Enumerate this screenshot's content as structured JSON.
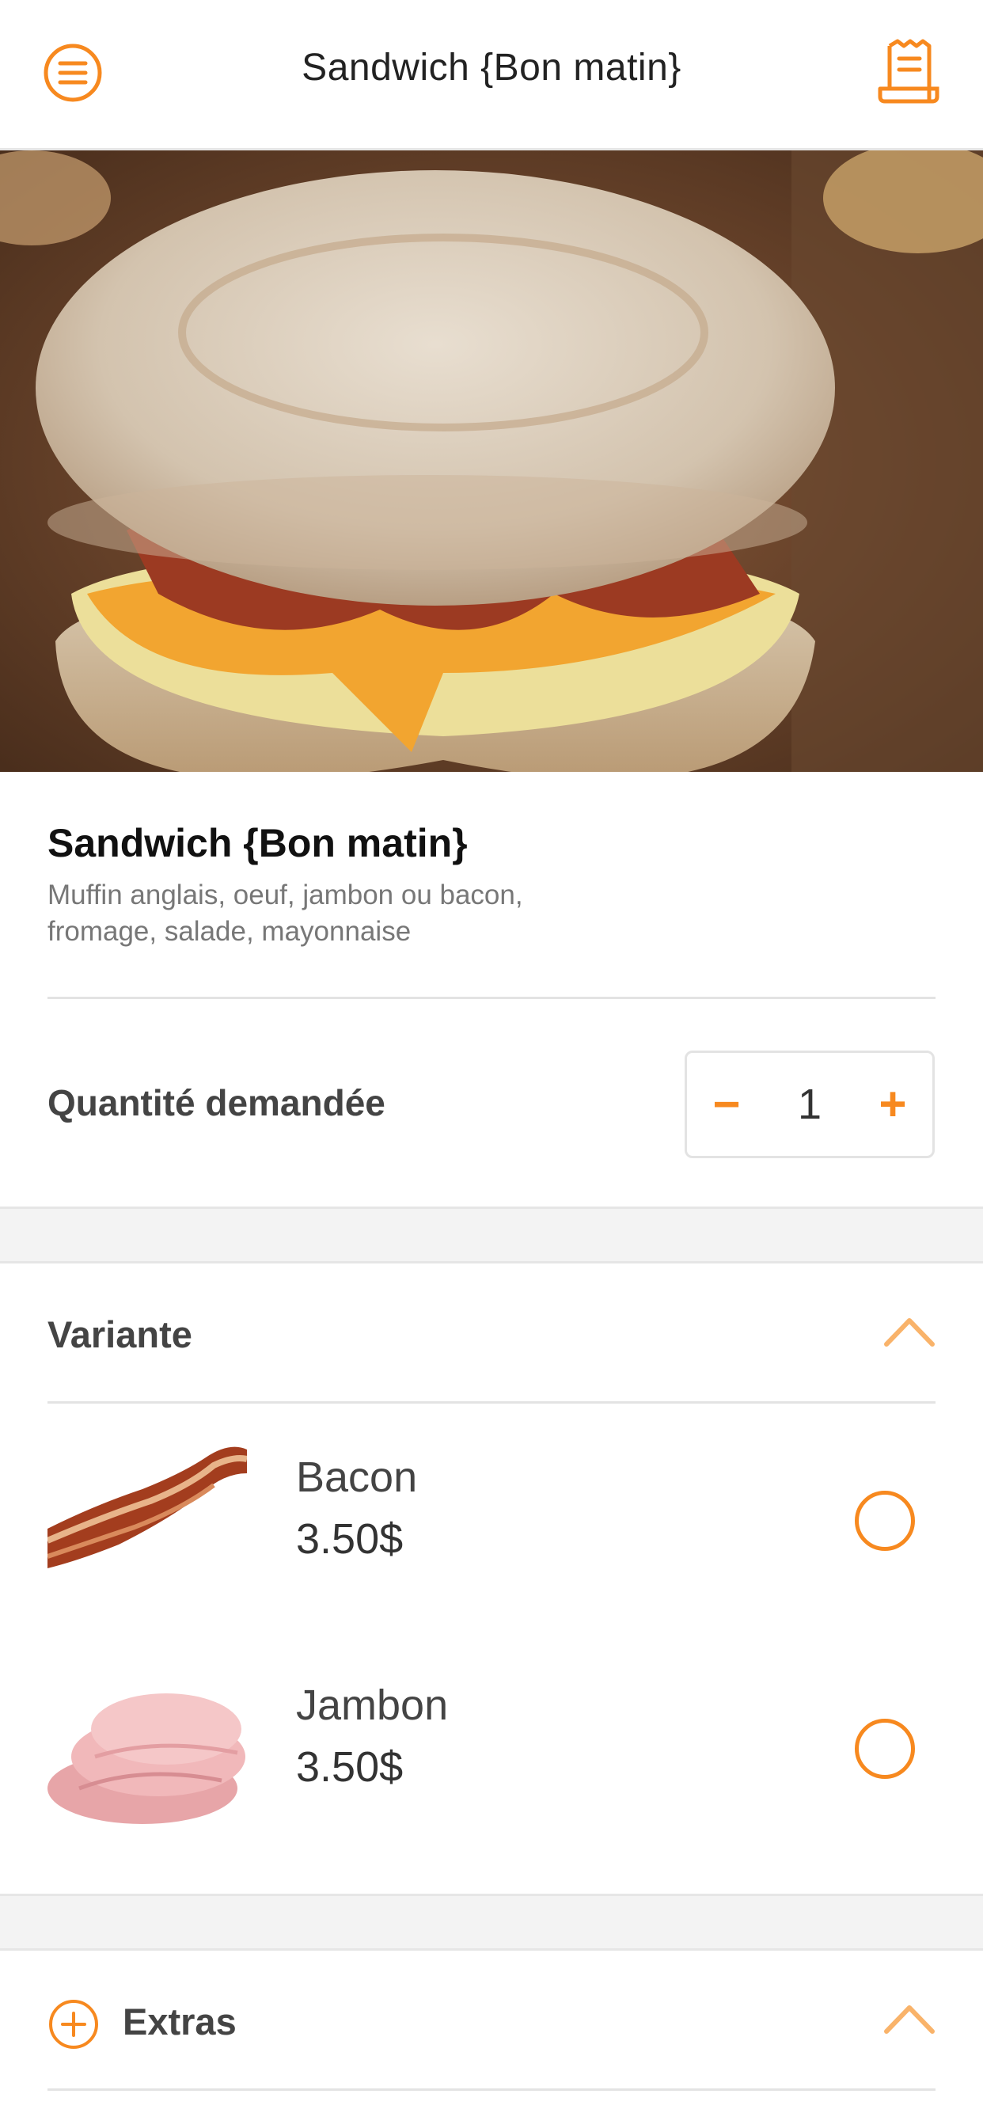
{
  "header": {
    "title": "Sandwich {Bon matin}",
    "menu_icon": "hamburger-menu-icon",
    "cart_icon": "receipt-icon"
  },
  "colors": {
    "accent": "#f7891f",
    "divider": "#e3e3e3",
    "section_gap": "#f3f3f3"
  },
  "product": {
    "name": "Sandwich {Bon matin}",
    "description": "Muffin anglais, oeuf, jambon ou bacon, fromage, salade, mayonnaise"
  },
  "quantity": {
    "label": "Quantité demandée",
    "value": "1",
    "minus": "−",
    "plus": "+"
  },
  "variant_section": {
    "title": "Variante",
    "items": [
      {
        "name": "Bacon",
        "price": "3.50$"
      },
      {
        "name": "Jambon",
        "price": "3.50$"
      }
    ]
  },
  "extras_section": {
    "title": "Extras"
  }
}
